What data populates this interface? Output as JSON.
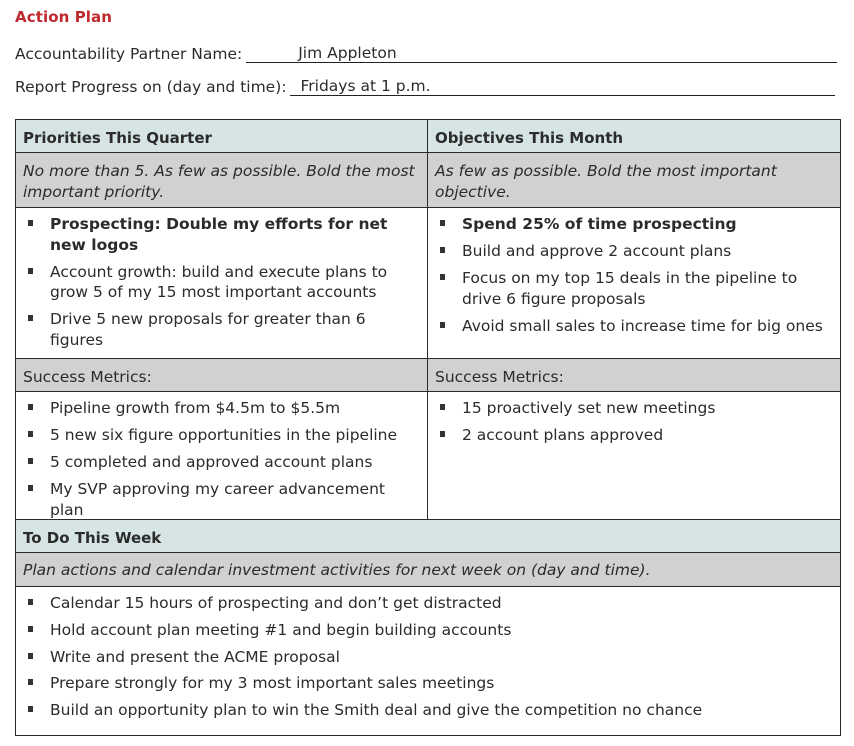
{
  "title": "Action Plan",
  "fields": {
    "partner": {
      "label": "Accountability Partner Name:",
      "value": "Jim Appleton"
    },
    "report": {
      "label": "Report Progress on (day and time):",
      "value": "Fridays at 1 p.m."
    }
  },
  "quarter": {
    "header": "Priorities This Quarter",
    "instruction": "No more than 5. As few as possible. Bold the most important priority.",
    "items": [
      {
        "text": "Prospecting: Double my efforts for net new logos",
        "bold": true
      },
      {
        "text": "Account growth: build and execute plans to grow 5 of my 15 most important accounts",
        "bold": false
      },
      {
        "text": "Drive 5 new proposals for greater than 6 figures",
        "bold": false
      }
    ],
    "metrics_label": "Success Metrics:",
    "metrics": [
      "Pipeline growth from $4.5m to $5.5m",
      "5 new six figure opportunities in the pipeline",
      "5 completed and approved account plans",
      "My SVP approving my career advancement plan"
    ]
  },
  "month": {
    "header": "Objectives This Month",
    "instruction": "As few as possible. Bold the most important objective.",
    "items": [
      {
        "text": "Spend 25% of time prospecting",
        "bold": true
      },
      {
        "text": "Build and approve 2 account plans",
        "bold": false
      },
      {
        "text": "Focus on my top 15 deals in the pipeline to drive 6 figure proposals",
        "bold": false
      },
      {
        "text": "Avoid small sales to increase time for big ones",
        "bold": false
      }
    ],
    "metrics_label": "Success Metrics:",
    "metrics": [
      "15 proactively set new meetings",
      "2 account plans approved"
    ]
  },
  "week": {
    "header": "To Do This Week",
    "instruction": "Plan actions and calendar investment activities for next week on (day and time).",
    "items": [
      "Calendar 15 hours of prospecting and don’t get distracted",
      "Hold account plan meeting #1 and begin building accounts",
      "Write and present the ACME proposal",
      "Prepare strongly for my 3 most important sales meetings",
      "Build an opportunity plan to win the Smith deal and give the competition no chance"
    ]
  },
  "colors": {
    "title": "#c0282d",
    "header_bg": "#d6e4e4",
    "instruction_bg": "#d1d1d3",
    "border": "#2a2a2a",
    "bullet": "#333333"
  }
}
